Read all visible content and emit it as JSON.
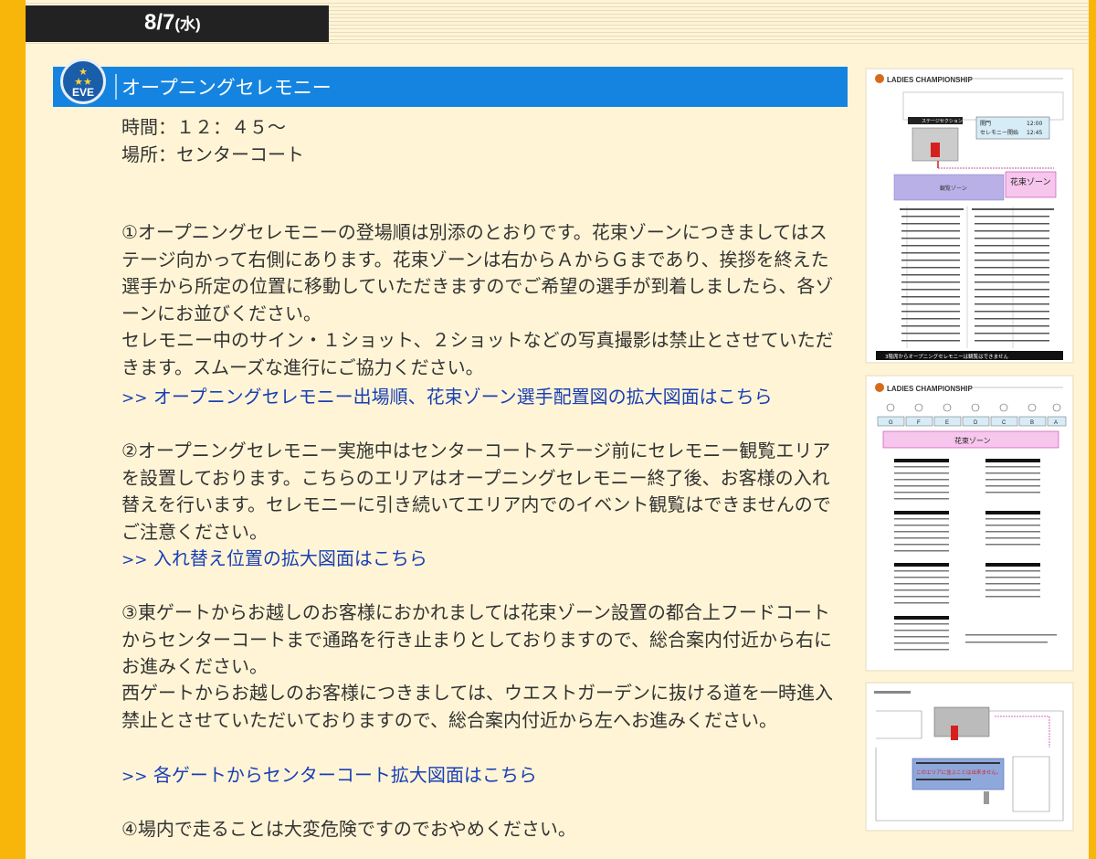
{
  "date_tab": {
    "date": "8/7",
    "weekday": "(水)"
  },
  "event": {
    "badge_label": "EVE",
    "title": "オープニングセレモニー",
    "time": "時間：１２：４５～",
    "place": "場所：センターコート"
  },
  "sections": [
    {
      "text": "①オープニングセレモニーの登場順は別添のとおりです。花束ゾーンにつきましてはステージ向かって右側にあります。花束ゾーンは右からＡからＧまであり、挨拶を終えた選手から所定の位置に移動していただきますのでご希望の選手が到着しましたら、各ゾーンにお並びください。",
      "text2": "セレモニー中のサイン・１ショット、２ショットなどの写真撮影は禁止とさせていただきます。スムーズな進行にご協力ください。",
      "link_arrow": ">>",
      "link": "オープニングセレモニー出場順、花束ゾーン選手配置図の拡大図面はこちら"
    },
    {
      "text": "②オープニングセレモニー実施中はセンターコートステージ前にセレモニー観覧エリアを設置しております。こちらのエリアはオープニングセレモニー終了後、お客様の入れ替えを行います。セレモニーに引き続いてエリア内でのイベント観覧はできませんのでご注意ください。",
      "link_arrow": ">>",
      "link": "入れ替え位置の拡大図面はこちら"
    },
    {
      "text": "③東ゲートからお越しのお客様におかれましては花束ゾーン設置の都合上フードコートからセンターコートまで通路を行き止まりとしておりますので、総合案内付近から右にお進みください。",
      "text2": "西ゲートからお越しのお客様につきましては、ウエストガーデンに抜ける道を一時進入禁止とさせていただいておりますので、総合案内付近から左へお進みください。",
      "link_arrow": ">>",
      "link": "各ゲートからセンターコート拡大図面はこちら"
    },
    {
      "text": "④場内で走ることは大変危険ですのでおやめください。"
    }
  ],
  "thumbnails": {
    "t1": {
      "header": "LADIES CHAMPIONSHIP",
      "stage": "ステージセクション",
      "open": "開門",
      "open_time": "12:00",
      "ceremony": "セレモニー開始",
      "ceremony_time": "12:45",
      "viewing": "観覧ゾーン",
      "bouquet": "花束ゾーン",
      "footer": "3階席からオープニングセレモニーは観覧はできません"
    },
    "t2": {
      "header": "LADIES CHAMPIONSHIP",
      "zones": [
        "G",
        "F",
        "E",
        "D",
        "C",
        "B",
        "A"
      ],
      "bouquet": "花束ゾーン"
    },
    "t3": {
      "notice": "このエリアに並ぶことは出来ません。"
    }
  },
  "colors": {
    "background": "#fff5d6",
    "frame": "#f9b60a",
    "header_blue": "#1584e0",
    "link": "#1a3fb5",
    "text": "#333333"
  }
}
